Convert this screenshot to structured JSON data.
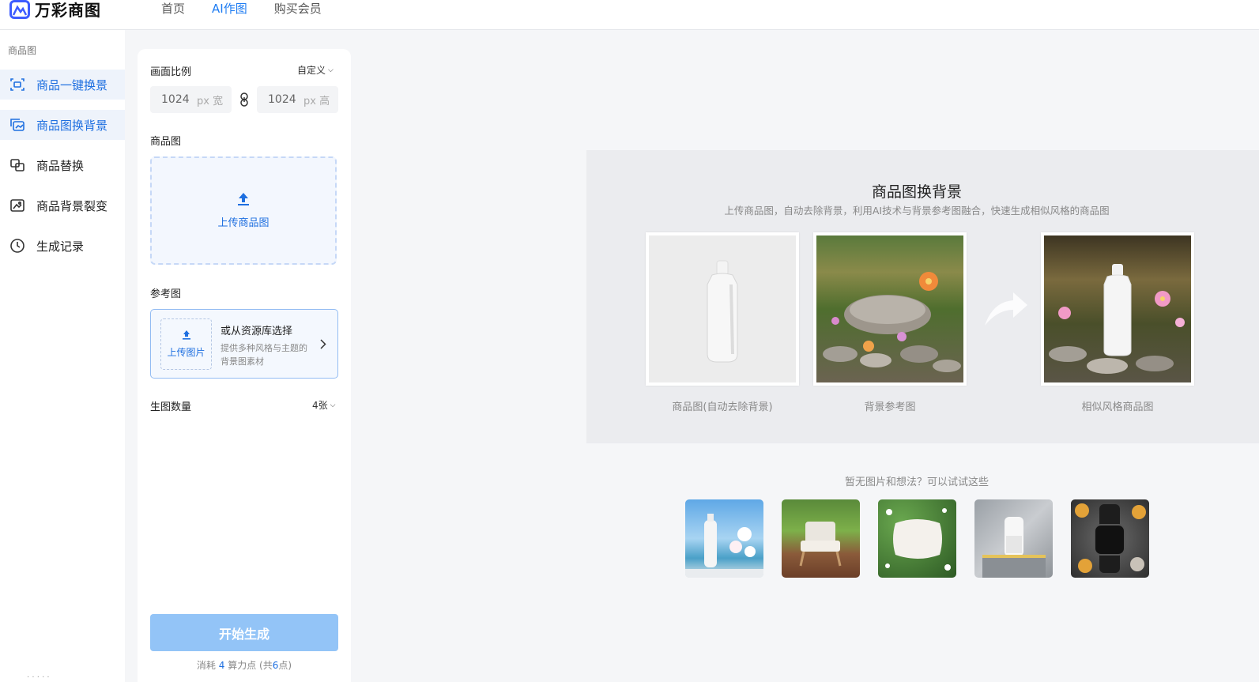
{
  "header": {
    "logo_text": "万彩商图",
    "nav": [
      "首页",
      "AI作图",
      "购买会员"
    ],
    "active_nav": "AI作图"
  },
  "sidebar": {
    "category": "商品图",
    "items": [
      {
        "label": "商品一键换景",
        "icon": "scene-swap-icon"
      },
      {
        "label": "商品图换背景",
        "icon": "background-swap-icon"
      },
      {
        "label": "商品替换",
        "icon": "product-replace-icon"
      },
      {
        "label": "商品背景裂变",
        "icon": "background-variant-icon"
      },
      {
        "label": "生成记录",
        "icon": "clock-icon"
      }
    ],
    "footer": "· · · · ·"
  },
  "panel": {
    "ratio_label": "画面比例",
    "ratio_value": "自定义",
    "width_value": "1024",
    "width_unit": "px 宽",
    "height_value": "1024",
    "height_unit": "px 高",
    "product_label": "商品图",
    "upload_product": "上传商品图",
    "ref_label": "参考图",
    "ref_upload": "上传图片",
    "ref_library_title": "或从资源库选择",
    "ref_library_desc": "提供多种风格与主题的背景图素材",
    "count_label": "生图数量",
    "count_value": "4张",
    "generate_button": "开始生成",
    "cost_prefix": "消耗",
    "cost_value": "4",
    "cost_mid": "算力点  (共",
    "cost_total": "6",
    "cost_suffix": "点)"
  },
  "demo": {
    "title": "商品图换背景",
    "subtitle": "上传商品图，自动去除背景，利用AI技术与背景参考图融合，快速生成相似风格的商品图",
    "captions": [
      "商品图(自动去除背景)",
      "背景参考图",
      "相似风格商品图"
    ]
  },
  "suggestions": {
    "text": "暂无图片和想法？可以试试这些"
  },
  "colors": {
    "accent": "#1e7cf2",
    "button_disabled": "#93c4f7"
  }
}
